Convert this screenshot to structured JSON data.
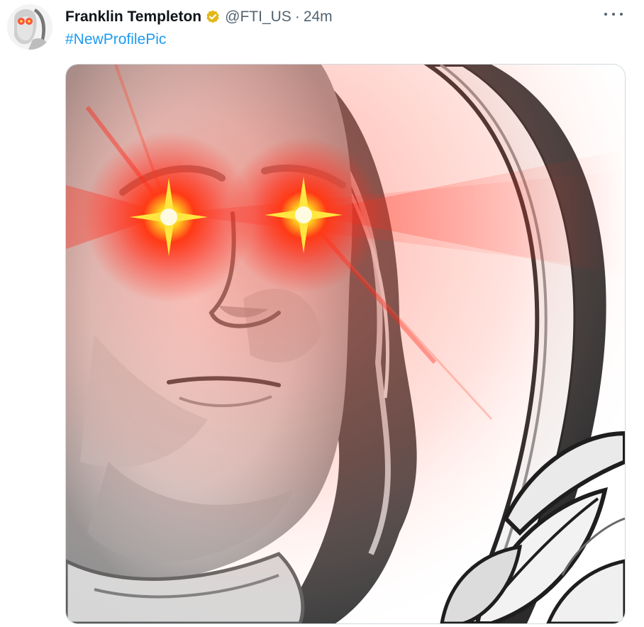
{
  "tweet": {
    "author": {
      "display_name": "Franklin Templeton",
      "verified_icon": "verified-badge-icon",
      "handle": "@FTI_US"
    },
    "separator": "·",
    "timestamp": "24m",
    "hashtag": "#NewProfilePic",
    "more_icon": "more-options-icon"
  },
  "colors": {
    "link": "#1d9bf0",
    "verified_gold": "#e2b719",
    "secondary_text": "#536471",
    "laser_red": "#ff2a1a",
    "laser_core": "#ffe640"
  }
}
